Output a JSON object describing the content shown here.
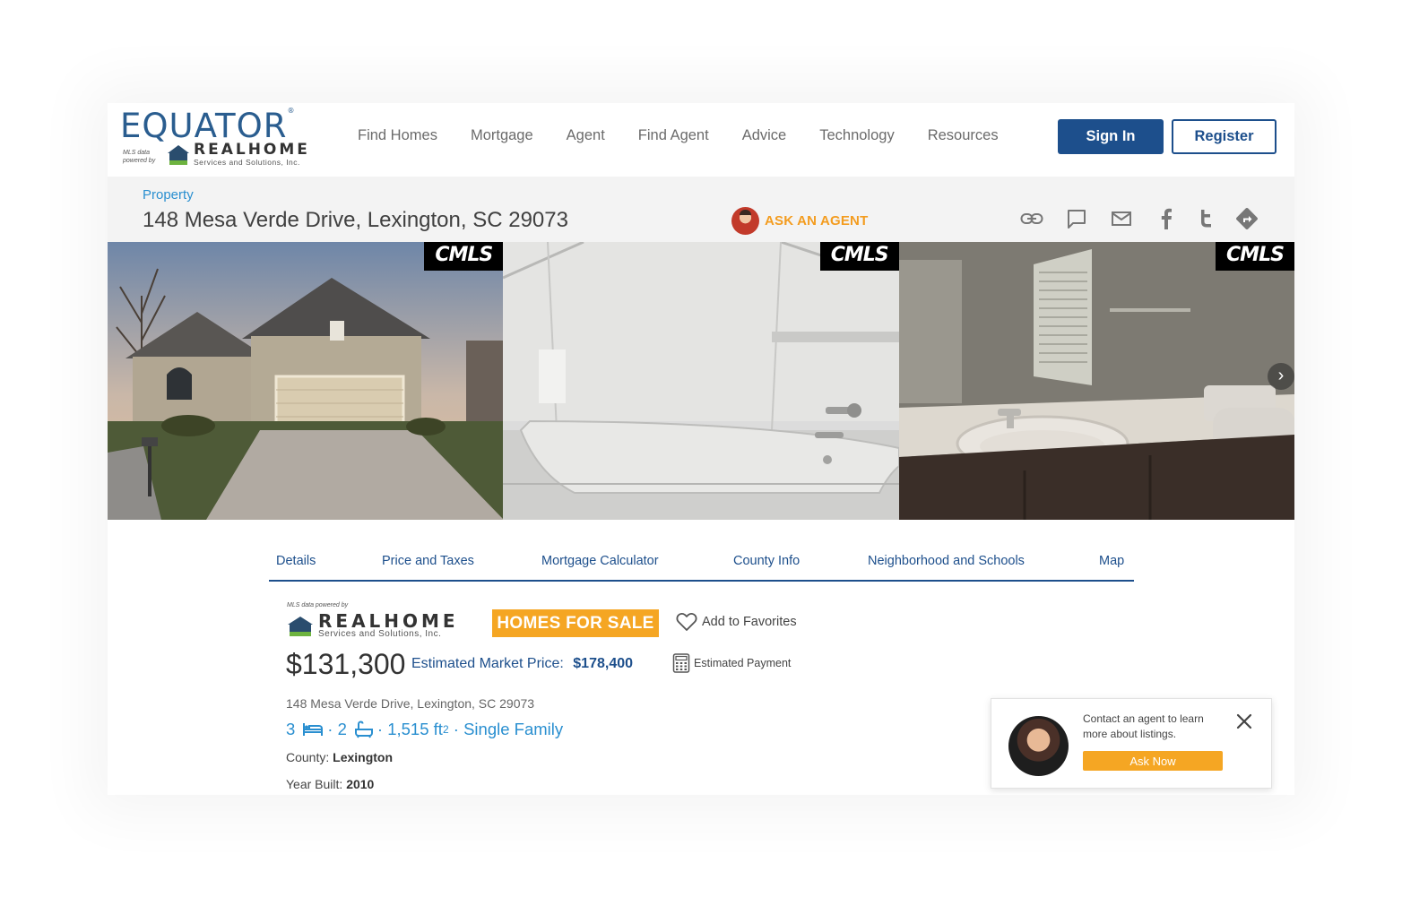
{
  "header": {
    "logo": {
      "brand": "EQUATOR",
      "powered_by": "MLS data powered by",
      "partner": "REALHOME",
      "partner_tagline": "Services and Solutions, Inc."
    },
    "nav": [
      "Find Homes",
      "Mortgage",
      "Agent",
      "Find Agent",
      "Advice",
      "Technology",
      "Resources"
    ],
    "sign_in": "Sign In",
    "register": "Register"
  },
  "property": {
    "label": "Property",
    "address": "148 Mesa Verde Drive, Lexington, SC 29073",
    "ask_agent": "ASK AN AGENT",
    "share_icons": [
      "link-icon",
      "comment-icon",
      "mail-icon",
      "facebook-icon",
      "twitter-icon",
      "directions-icon"
    ]
  },
  "gallery": {
    "watermark": "CMLS",
    "photos": [
      "house-exterior",
      "bathtub",
      "bathroom-vanity"
    ]
  },
  "tabs": [
    "Details",
    "Price and Taxes",
    "Mortgage Calculator",
    "County Info",
    "Neighborhood and Schools",
    "Map"
  ],
  "listing": {
    "mls_powered_by": "MLS data powered by",
    "partner": "REALHOME",
    "partner_tagline": "Services and Solutions, Inc.",
    "status_badge": "HOMES FOR SALE",
    "favorite": "Add to Favorites",
    "price": "$131,300",
    "estimated_market_label": "Estimated Market Price:",
    "estimated_market_value": "$178,400",
    "estimated_payment": "Estimated Payment",
    "address": "148 Mesa Verde Drive, Lexington, SC 29073",
    "beds": "3",
    "baths": "2",
    "area": "1,515 ft",
    "area_unit_sup": "2",
    "type": "Single Family",
    "county_label": "County:",
    "county": "Lexington",
    "year_label": "Year Built:",
    "year": "2010"
  },
  "popup": {
    "text": "Contact an agent to learn more about listings.",
    "button": "Ask Now"
  },
  "colors": {
    "primary": "#1d4f8c",
    "accent": "#f5a623",
    "link": "#2a8fd0"
  }
}
